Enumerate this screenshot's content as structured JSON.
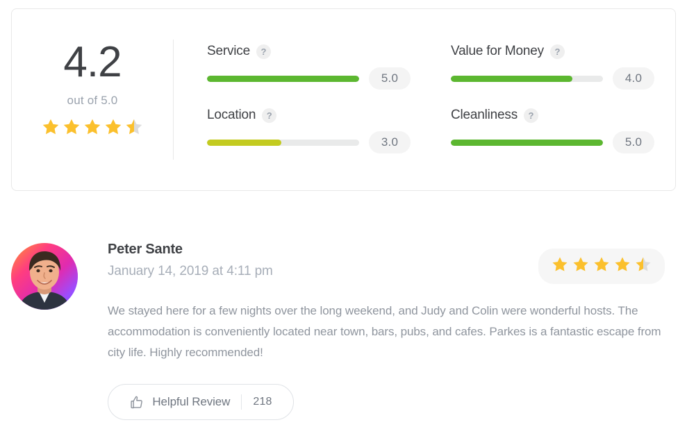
{
  "summary": {
    "score": "4.2",
    "out_of_label": "out of 5.0",
    "stars": 4.5,
    "max_stars": 5,
    "criteria": [
      {
        "label": "Service",
        "value": "5.0",
        "percent": 100,
        "color": "#5cb730",
        "help_icon": "question-mark-icon",
        "help_glyph": "?"
      },
      {
        "label": "Value for Money",
        "value": "4.0",
        "percent": 80,
        "color": "#5cb730",
        "help_icon": "question-mark-icon",
        "help_glyph": "?"
      },
      {
        "label": "Location",
        "value": "3.0",
        "percent": 49,
        "color": "#c3cb20",
        "help_icon": "question-mark-icon",
        "help_glyph": "?"
      },
      {
        "label": "Cleanliness",
        "value": "5.0",
        "percent": 100,
        "color": "#5cb730",
        "help_icon": "question-mark-icon",
        "help_glyph": "?"
      }
    ]
  },
  "review": {
    "avatar_icon": "user-avatar-photo",
    "reviewer_name": "Peter Sante",
    "date": "January 14, 2019 at 4:11 pm",
    "stars": 4.5,
    "max_stars": 5,
    "text": "We stayed here for a few nights over the long weekend, and Judy and Colin were wonderful hosts. The accommodation is conveniently located near town, bars, pubs, and cafes. Parkes is a fantastic escape from city life. Highly recommended!",
    "helpful": {
      "icon": "thumbs-up-icon",
      "label": "Helpful Review",
      "count": "218"
    }
  },
  "colors": {
    "star_gold": "#fbc02d",
    "star_empty": "#dcdcdc",
    "green": "#5cb730",
    "olive": "#c3cb20",
    "card_border": "#e8e8e8",
    "track": "#e9eaea",
    "text_dark": "#3f4145",
    "text_muted": "#9aa2ad"
  }
}
